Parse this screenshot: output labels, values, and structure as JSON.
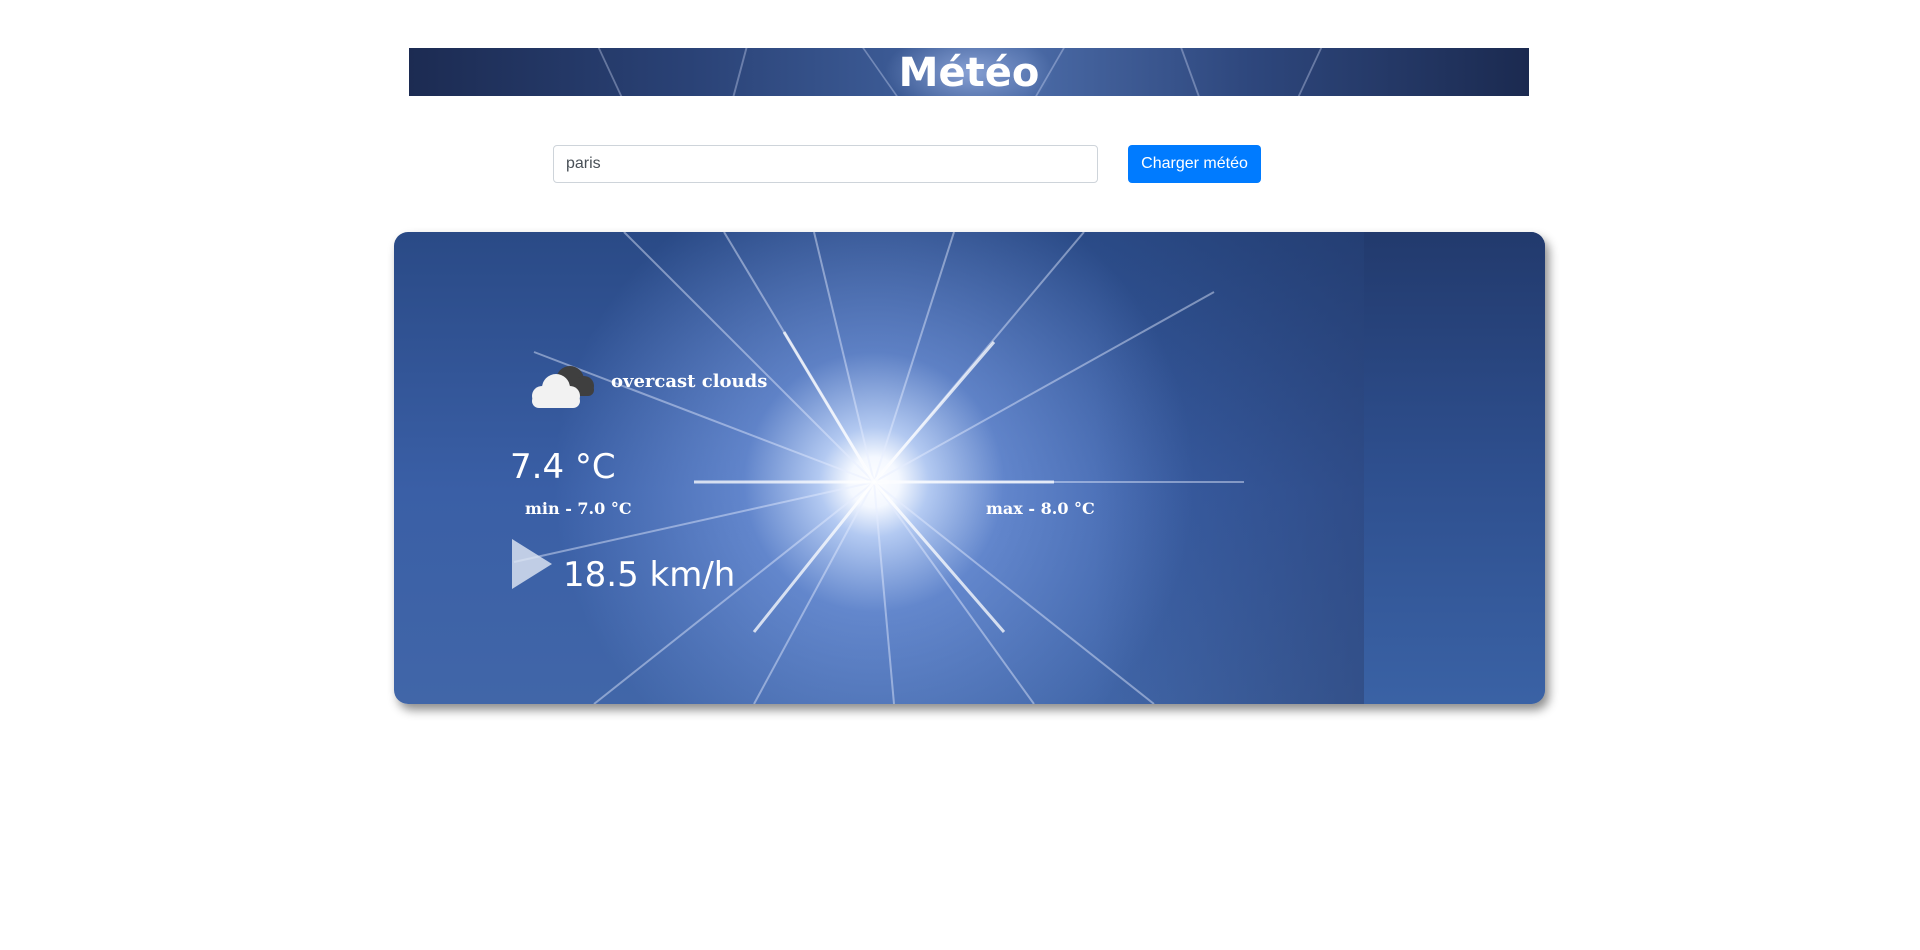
{
  "header": {
    "title": "Météo"
  },
  "search": {
    "value": "paris",
    "button_label": "Charger météo"
  },
  "weather": {
    "condition_icon": "cloud-icon",
    "condition": "overcast clouds",
    "temperature": "7.4 °C",
    "min": "min - 7.0 °C",
    "max": "max - 8.0 °C",
    "wind_icon": "wind-direction-arrow-icon",
    "wind_speed": "18.5 km/h"
  },
  "colors": {
    "accent": "#007bff",
    "banner": "#2a4276",
    "card": "#3a5fa6",
    "text_on_card": "#ffffff"
  }
}
